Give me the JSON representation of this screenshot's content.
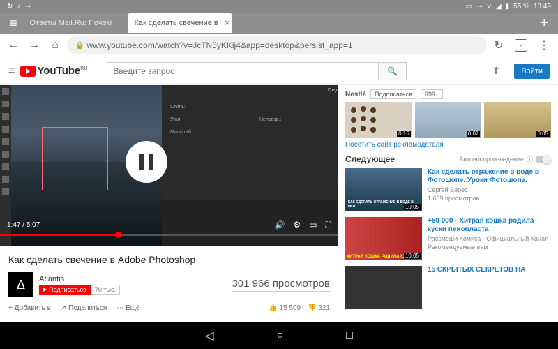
{
  "statusbar": {
    "battery": "55 %",
    "time": "18:49"
  },
  "tabs": {
    "tab1": "Ответы Mail.Ru: Почем",
    "tab2": "Как сделать свечение в"
  },
  "urlbar": {
    "url": "www.youtube.com/watch?v=JcTN5yKKij4&app=desktop&persist_app=1",
    "tabcount": "2"
  },
  "youtube": {
    "logo_text": "YouTube",
    "region": "RU",
    "search_placeholder": "Введите запрос",
    "signin": "Войти"
  },
  "player": {
    "current_time": "1:47",
    "duration": "5:07",
    "time_display": "1:47 / 5:07"
  },
  "video": {
    "title": "Как сделать свечение в Adobe Photoshop",
    "channel": "Atlantis",
    "channel_initial": "Δ",
    "subscribe_label": "Подписаться",
    "subscriber_count": "70 тыс.",
    "views": "301 966 просмотров",
    "add": "Добавить в",
    "share": "Поделиться",
    "more": "Ещё",
    "likes": "15 509",
    "dislikes": "321"
  },
  "ads": {
    "brand": "Nestlé",
    "subscribe": "Подписаться",
    "subcount": "999+",
    "dur1": "0:07",
    "dur2": "0:16",
    "dur3": "0:05",
    "link": "Посетить сайт рекламодателя"
  },
  "upnext": {
    "label": "Следующее",
    "autoplay": "Автовоспроизведение"
  },
  "recs": [
    {
      "title": "Как сделать отражение в воде в Фотошопе. Уроки Фотошопа.",
      "channel": "Сергей Верес",
      "views": "1 639 просмотров",
      "dur": "10:05",
      "thumb_text": "КАК СДЕЛАТЬ\nОТРАЖЕНИЕ\nВ ВОДЕ\nВ ФОТ"
    },
    {
      "title": "+50 000 - Хитрая кошка родила куски пенопласта",
      "channel": "Рассмеши Комика - Официальный Канал",
      "views": "Рекомендуемые вам",
      "dur": "10:05",
      "thumb_text": "ХИТРАЯ КОШКА РОДИЛА КУ"
    },
    {
      "title": "15 СКРЫТЫХ СЕКРЕТОВ НА",
      "channel": "",
      "views": "",
      "dur": ""
    }
  ]
}
